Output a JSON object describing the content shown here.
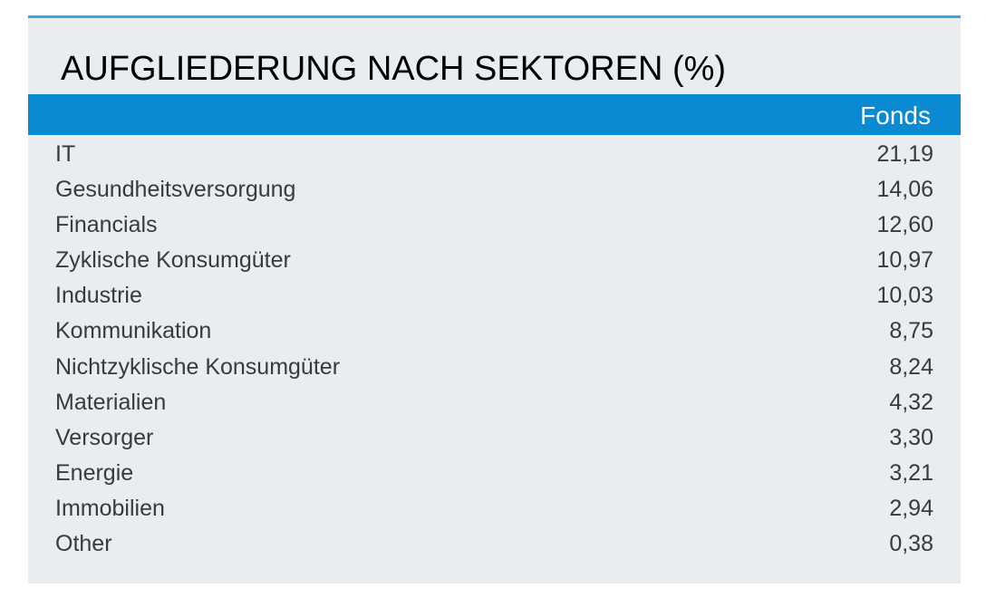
{
  "title": "AUFGLIEDERUNG NACH SEKTOREN (%)",
  "column_header": "Fonds",
  "colors": {
    "panel_background": "#e9edf0",
    "top_border": "#3aa6dd",
    "header_bar": "#0a8ad2",
    "header_text": "#ffffff",
    "row_text": "#3a3a3a"
  },
  "rows": [
    {
      "label": "IT",
      "value": "21,19"
    },
    {
      "label": "Gesundheitsversorgung",
      "value": "14,06"
    },
    {
      "label": "Financials",
      "value": "12,60"
    },
    {
      "label": "Zyklische Konsumgüter",
      "value": "10,97"
    },
    {
      "label": "Industrie",
      "value": "10,03"
    },
    {
      "label": "Kommunikation",
      "value": "8,75"
    },
    {
      "label": "Nichtzyklische Konsumgüter",
      "value": "8,24"
    },
    {
      "label": "Materialien",
      "value": "4,32"
    },
    {
      "label": "Versorger",
      "value": "3,30"
    },
    {
      "label": "Energie",
      "value": "3,21"
    },
    {
      "label": "Immobilien",
      "value": "2,94"
    },
    {
      "label": "Other",
      "value": "0,38"
    }
  ]
}
